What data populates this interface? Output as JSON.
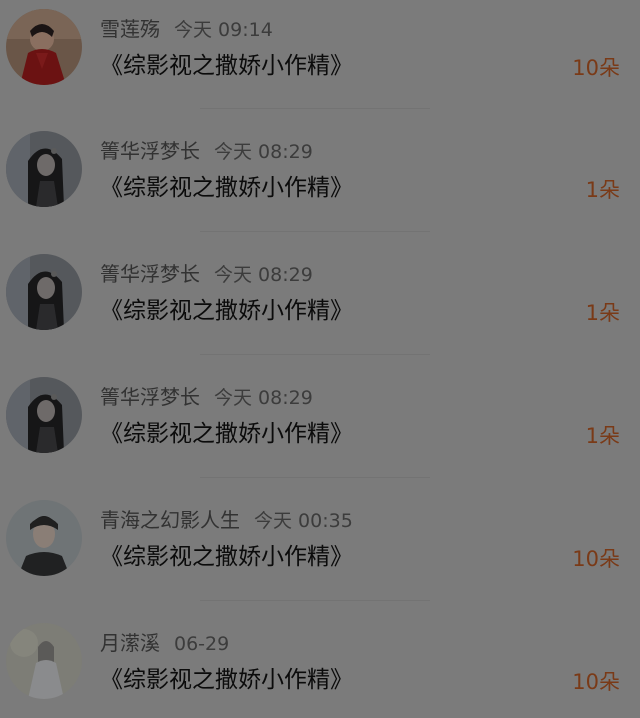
{
  "comments": [
    {
      "user": "雪莲殇",
      "time": "今天 09:14",
      "book": "《综影视之撒娇小作精》",
      "count": "10朵",
      "avatar_icon": "red-costume-avatar"
    },
    {
      "user": "箐华浮梦长",
      "time": "今天 08:29",
      "book": "《综影视之撒娇小作精》",
      "count": "1朵",
      "avatar_icon": "dark-hair-avatar"
    },
    {
      "user": "箐华浮梦长",
      "time": "今天 08:29",
      "book": "《综影视之撒娇小作精》",
      "count": "1朵",
      "avatar_icon": "dark-hair-avatar"
    },
    {
      "user": "箐华浮梦长",
      "time": "今天 08:29",
      "book": "《综影视之撒娇小作精》",
      "count": "1朵",
      "avatar_icon": "dark-hair-avatar"
    },
    {
      "user": "青海之幻影人生",
      "time": "今天 00:35",
      "book": "《综影视之撒娇小作精》",
      "count": "10朵",
      "avatar_icon": "young-man-avatar"
    },
    {
      "user": "月潆溪",
      "time": "06-29",
      "book": "《综影视之撒娇小作精》",
      "count": "10朵",
      "avatar_icon": "white-dress-avatar"
    }
  ],
  "colors": {
    "background": "#7b7b7b",
    "count_accent": "#7a3a17"
  }
}
